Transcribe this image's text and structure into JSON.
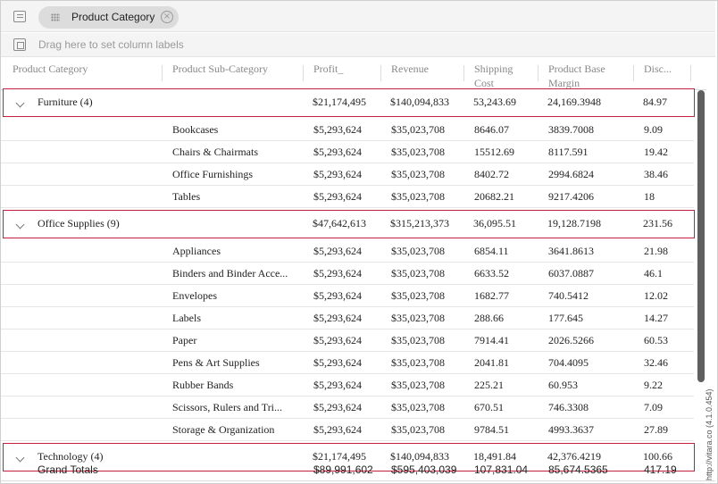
{
  "group_panel": {
    "chip_label": "Product Category",
    "column_labels_placeholder": "Drag here to set column labels"
  },
  "columns": [
    [
      "Product Category"
    ],
    [
      "Product Sub-Category"
    ],
    [
      "Profit_"
    ],
    [
      "Revenue"
    ],
    [
      "Shipping",
      "Cost"
    ],
    [
      "Product Base",
      "Margin"
    ],
    [
      "Disc..."
    ]
  ],
  "groups": [
    {
      "label": "Furniture (4)",
      "values": [
        "$21,174,495",
        "$140,094,833",
        "53,243.69",
        "24,169.3948",
        "84.97"
      ],
      "rows": [
        [
          "Bookcases",
          "$5,293,624",
          "$35,023,708",
          "8646.07",
          "3839.7008",
          "9.09"
        ],
        [
          "Chairs & Chairmats",
          "$5,293,624",
          "$35,023,708",
          "15512.69",
          "8117.591",
          "19.42"
        ],
        [
          "Office Furnishings",
          "$5,293,624",
          "$35,023,708",
          "8402.72",
          "2994.6824",
          "38.46"
        ],
        [
          "Tables",
          "$5,293,624",
          "$35,023,708",
          "20682.21",
          "9217.4206",
          "18"
        ]
      ]
    },
    {
      "label": "Office Supplies (9)",
      "values": [
        "$47,642,613",
        "$315,213,373",
        "36,095.51",
        "19,128.7198",
        "231.56"
      ],
      "rows": [
        [
          "Appliances",
          "$5,293,624",
          "$35,023,708",
          "6854.11",
          "3641.8613",
          "21.98"
        ],
        [
          "Binders and Binder Acce...",
          "$5,293,624",
          "$35,023,708",
          "6633.52",
          "6037.0887",
          "46.1"
        ],
        [
          "Envelopes",
          "$5,293,624",
          "$35,023,708",
          "1682.77",
          "740.5412",
          "12.02"
        ],
        [
          "Labels",
          "$5,293,624",
          "$35,023,708",
          "288.66",
          "177.645",
          "14.27"
        ],
        [
          "Paper",
          "$5,293,624",
          "$35,023,708",
          "7914.41",
          "2026.5266",
          "60.53"
        ],
        [
          "Pens & Art Supplies",
          "$5,293,624",
          "$35,023,708",
          "2041.81",
          "704.4095",
          "32.46"
        ],
        [
          "Rubber Bands",
          "$5,293,624",
          "$35,023,708",
          "225.21",
          "60.953",
          "9.22"
        ],
        [
          "Scissors, Rulers and Tri...",
          "$5,293,624",
          "$35,023,708",
          "670.51",
          "746.3308",
          "7.09"
        ],
        [
          "Storage & Organization",
          "$5,293,624",
          "$35,023,708",
          "9784.51",
          "4993.3637",
          "27.89"
        ]
      ]
    },
    {
      "label": "Technology (4)",
      "values": [
        "$21,174,495",
        "$140,094,833",
        "18,491.84",
        "42,376.4219",
        "100.66"
      ],
      "rows": []
    }
  ],
  "grand_totals": {
    "label": "Grand Totals",
    "values": [
      "$89,991,602",
      "$595,403,039",
      "107,831.04",
      "85,674.5365",
      "417.19"
    ]
  },
  "watermark": "http://vitara.co (4.1.0.454)"
}
